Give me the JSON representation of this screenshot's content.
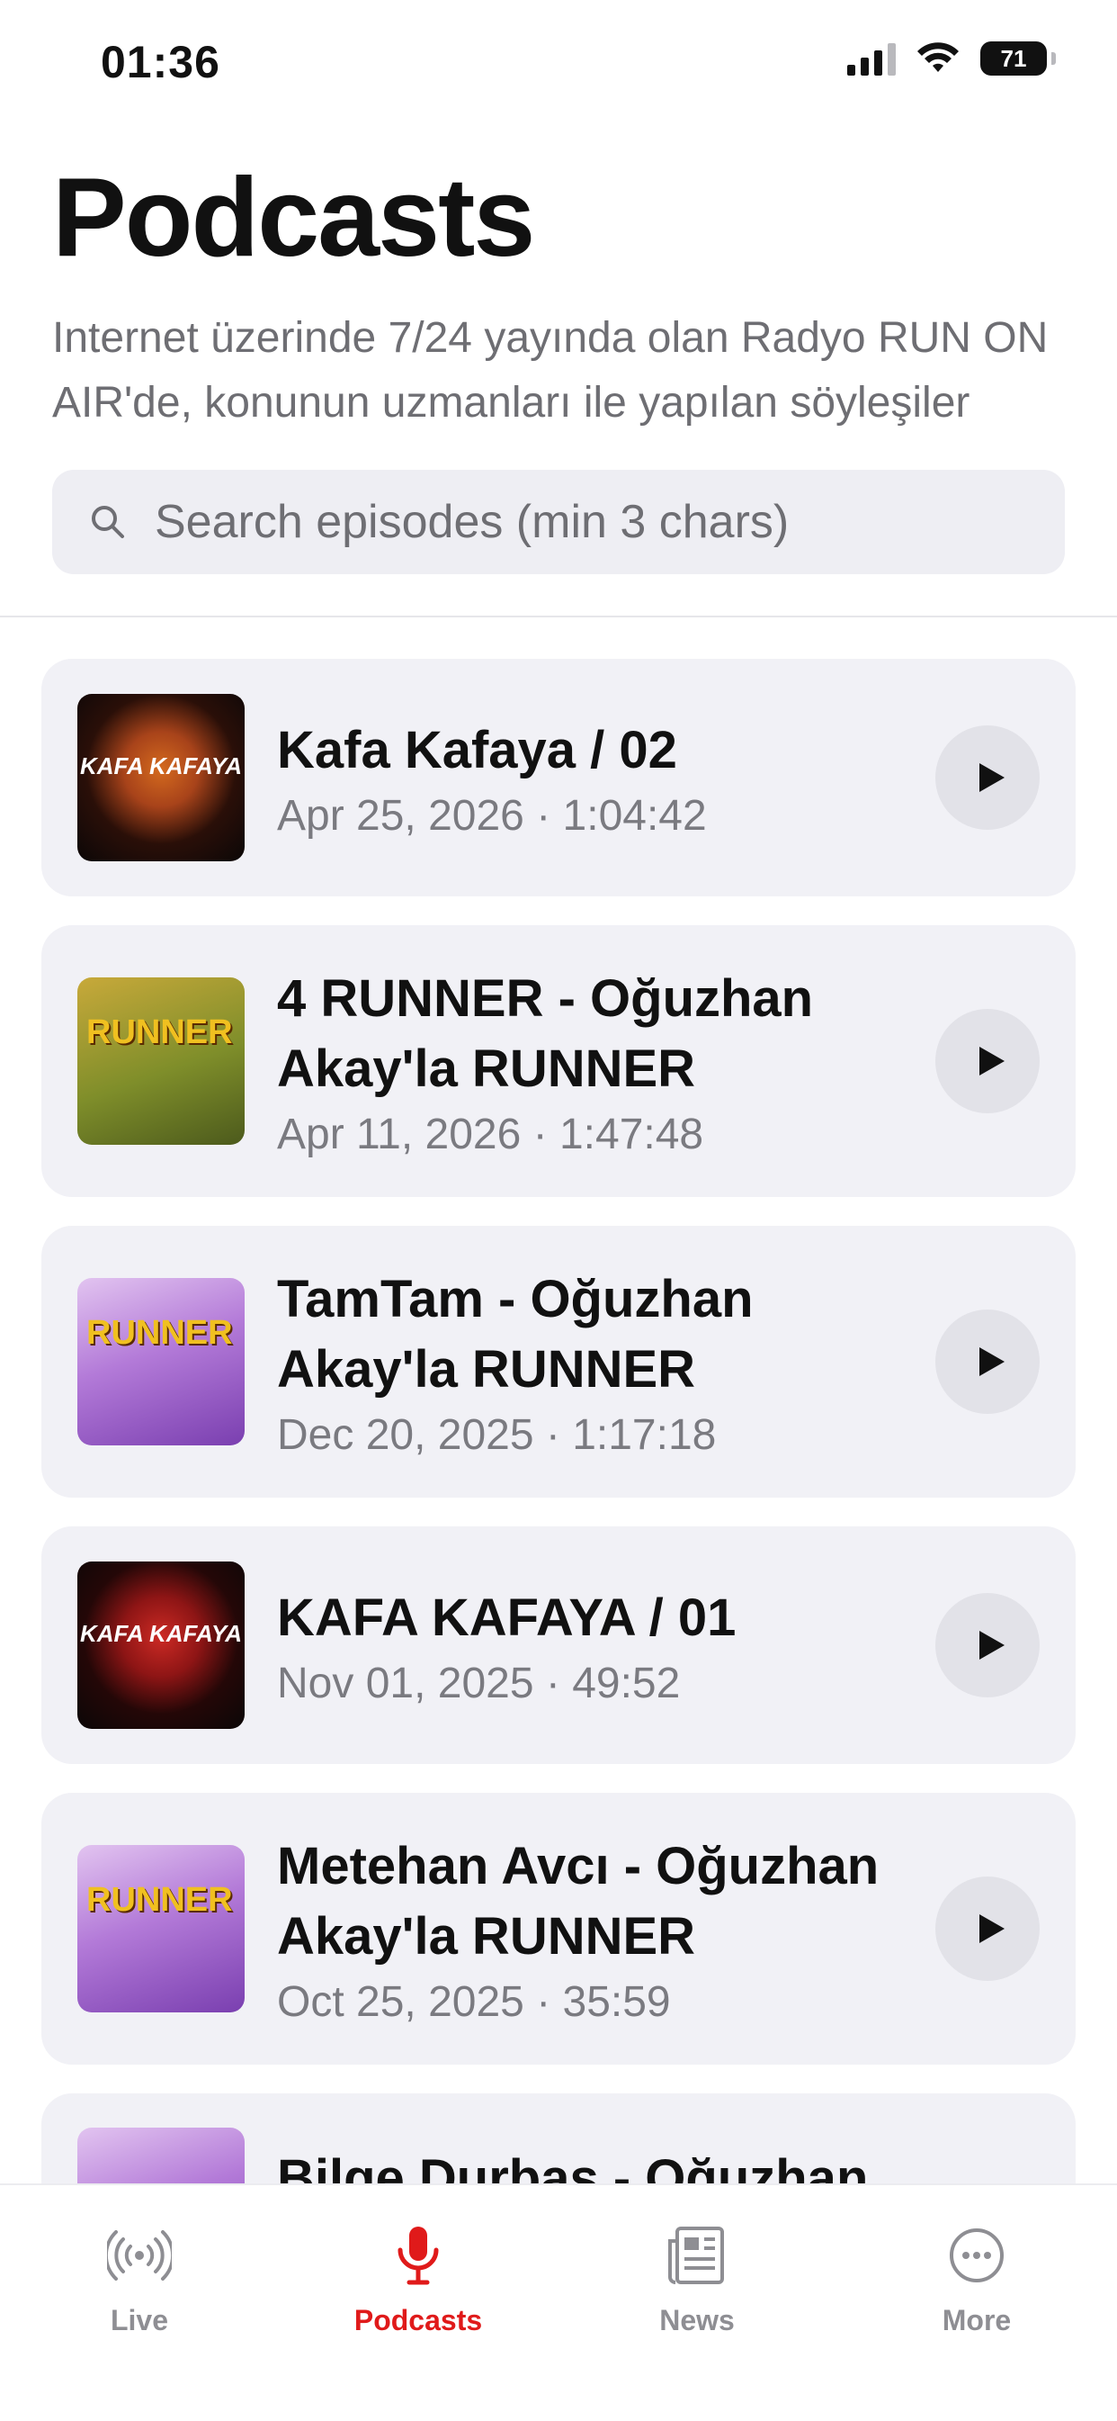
{
  "status_bar": {
    "time": "01:36",
    "battery": "71"
  },
  "header": {
    "title": "Podcasts",
    "description": "Internet üzerinde 7/24 yayında olan Radyo RUN ON AIR'de, konunun uzmanları ile yapılan söyleşiler"
  },
  "search": {
    "placeholder": "Search episodes (min 3 chars)",
    "value": ""
  },
  "episodes": [
    {
      "title": "Kafa Kafaya / 02",
      "meta": "Apr 25, 2026 · 1:04:42",
      "art_text": "KAFA KAFAYA"
    },
    {
      "title": "4 RUNNER - Oğuzhan Akay'la RUNNER",
      "meta": "Apr 11, 2026 · 1:47:48",
      "art_text": "RUNNER"
    },
    {
      "title": "TamTam - Oğuzhan Akay'la RUNNER",
      "meta": "Dec 20, 2025 · 1:17:18",
      "art_text": "RUNNER"
    },
    {
      "title": "KAFA KAFAYA / 01",
      "meta": "Nov 01, 2025 · 49:52",
      "art_text": "KAFA KAFAYA"
    },
    {
      "title": "Metehan Avcı - Oğuzhan Akay'la RUNNER",
      "meta": "Oct 25, 2025 · 35:59",
      "art_text": "RUNNER"
    },
    {
      "title": "Bilge Durbaş - Oğuzhan",
      "meta": "",
      "art_text": ""
    }
  ],
  "tabs": [
    {
      "label": "Live",
      "icon": "broadcast-icon"
    },
    {
      "label": "Podcasts",
      "icon": "microphone-icon",
      "active": true
    },
    {
      "label": "News",
      "icon": "newspaper-icon"
    },
    {
      "label": "More",
      "icon": "ellipsis-circle-icon"
    }
  ],
  "colors": {
    "accent": "#e01a1a",
    "card_bg": "#f1f1f6",
    "inactive": "#8e8e93"
  }
}
